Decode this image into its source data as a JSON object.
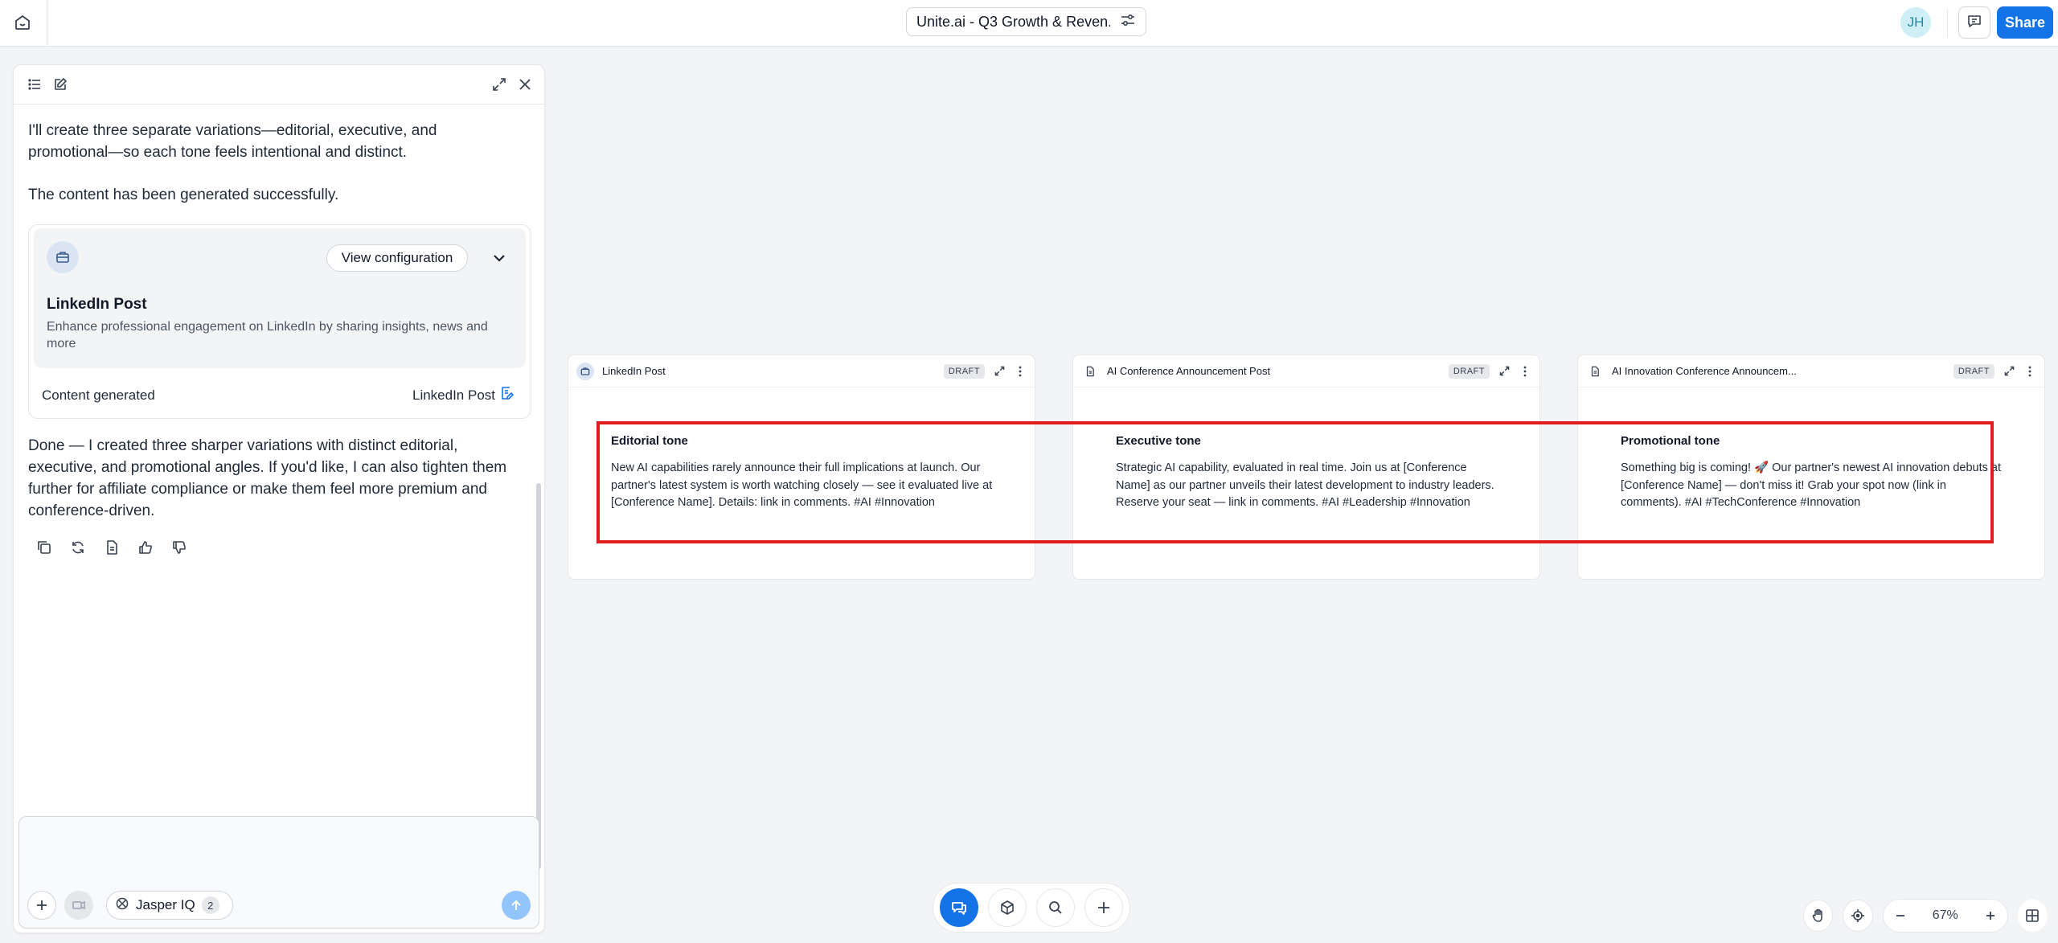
{
  "header": {
    "doc_title": "Unite.ai - Q3 Growth & Reven...",
    "avatar_initials": "JH",
    "share_label": "Share"
  },
  "chat": {
    "message_1": "I'll create three separate variations—editorial, executive, and promotional—so each tone feels intentional and distinct.",
    "message_2": "The content has been generated successfully.",
    "config_card": {
      "view_config_label": "View configuration",
      "title": "LinkedIn Post",
      "description": "Enhance professional engagement on LinkedIn by sharing insights, news and more",
      "status": "Content generated",
      "link_label": "LinkedIn Post"
    },
    "message_3": "Done — I created three sharper variations with distinct editorial, executive, and promotional angles. If you'd like, I can also tighten them further for affiliate compliance or make them feel more premium and conference-driven.",
    "composer": {
      "placeholder": "",
      "model_label": "Jasper IQ",
      "model_count": "2"
    }
  },
  "cards": [
    {
      "title": "LinkedIn Post",
      "badge": "DRAFT",
      "heading": "Editorial tone",
      "body": "New AI capabilities rarely announce their full implications at launch. Our partner's latest system is worth watching closely — see it evaluated live at [Conference Name]. Details: link in comments. #AI #Innovation"
    },
    {
      "title": "AI Conference Announcement Post",
      "badge": "DRAFT",
      "heading": "Executive tone",
      "body": "Strategic AI capability, evaluated in real time. Join us at [Conference Name] as our partner unveils their latest development to industry leaders. Reserve your seat — link in comments. #AI #Leadership #Innovation"
    },
    {
      "title": "AI Innovation Conference Announcem...",
      "badge": "DRAFT",
      "heading": "Promotional tone",
      "body": "Something big is coming! 🚀 Our partner's newest AI innovation debuts at [Conference Name] — don't miss it! Grab your spot now (link in comments). #AI #TechConference #Innovation"
    }
  ],
  "zoom": {
    "level": "67%"
  },
  "colors": {
    "accent": "#1473e6",
    "highlight": "#e11d1d"
  }
}
